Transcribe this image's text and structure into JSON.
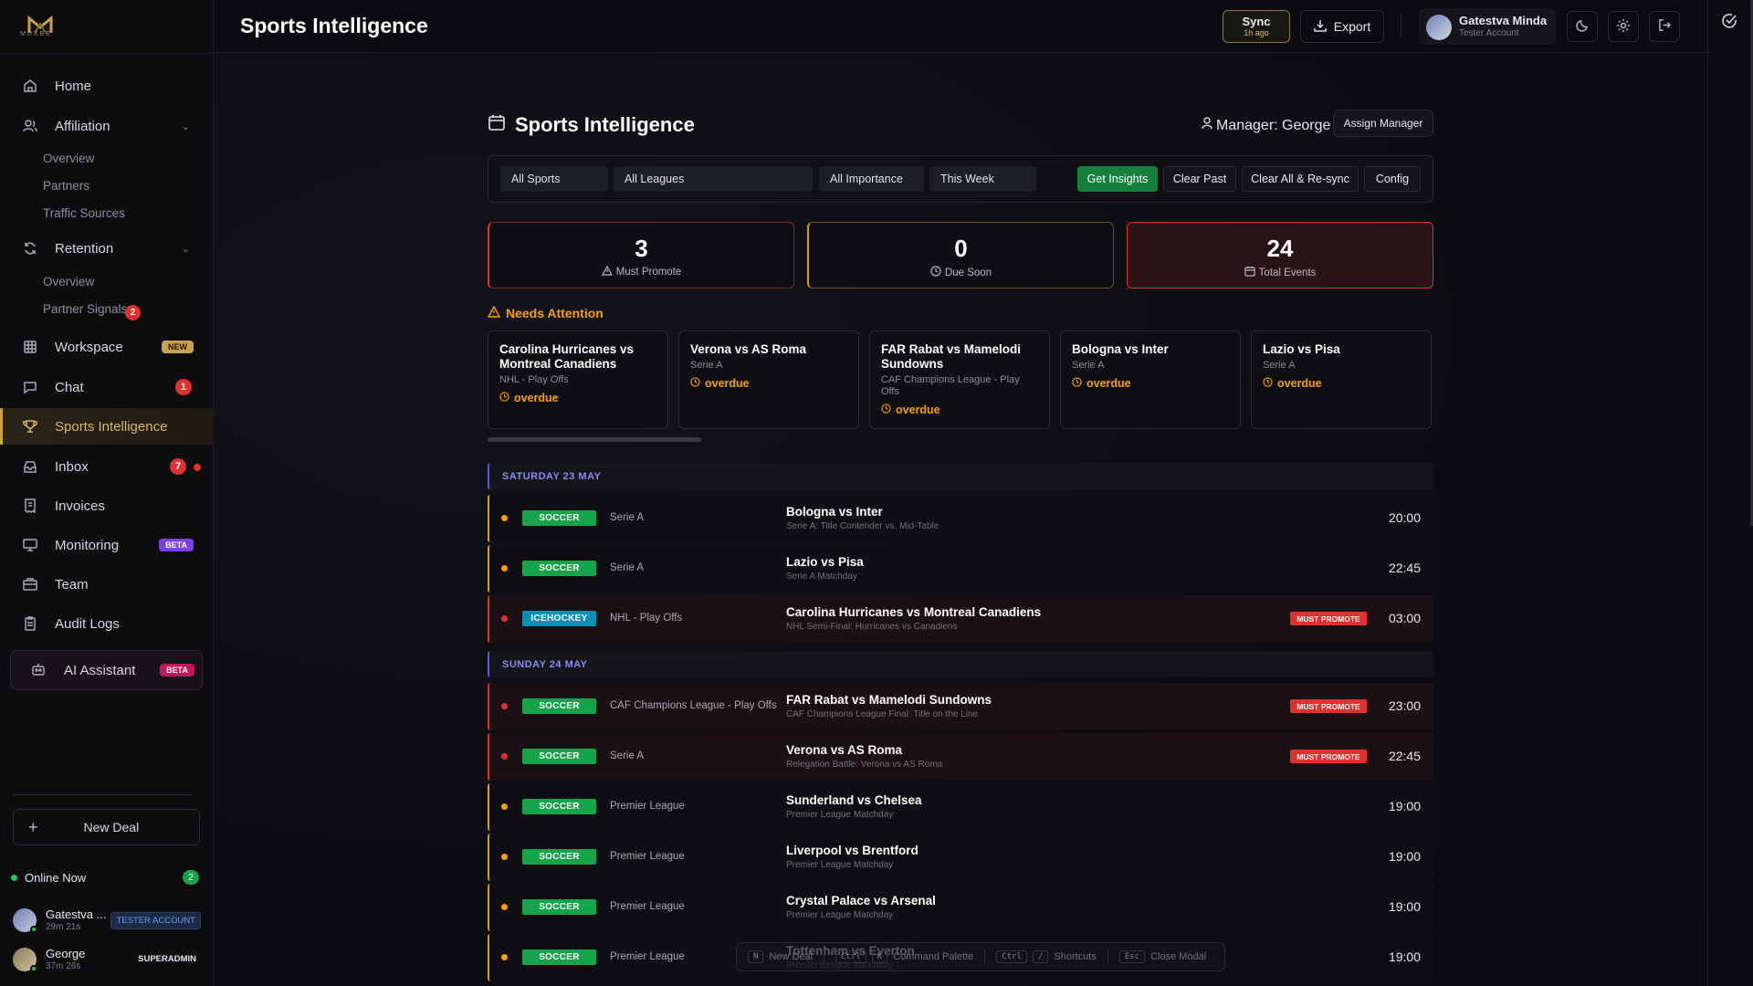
{
  "brand": {
    "name": "MUXBE"
  },
  "sidebar": {
    "items": [
      {
        "label": "Home",
        "icon": "home-icon"
      },
      {
        "label": "Affiliation",
        "icon": "users-icon",
        "sub": [
          "Overview",
          "Partners",
          "Traffic Sources"
        ]
      },
      {
        "label": "Retention",
        "icon": "refresh-icon",
        "sub": [
          "Overview",
          "Partner Signals"
        ],
        "sub_badge": "2"
      },
      {
        "label": "Workspace",
        "icon": "grid-icon",
        "badge": "NEW"
      },
      {
        "label": "Chat",
        "icon": "chat-icon",
        "count": "1"
      },
      {
        "label": "Sports Intelligence",
        "icon": "trophy-icon"
      },
      {
        "label": "Inbox",
        "icon": "inbox-icon",
        "count": "7"
      },
      {
        "label": "Invoices",
        "icon": "receipt-icon"
      },
      {
        "label": "Monitoring",
        "icon": "monitor-icon",
        "badge": "BETA"
      },
      {
        "label": "Team",
        "icon": "briefcase-icon"
      },
      {
        "label": "Audit Logs",
        "icon": "clipboard-icon"
      }
    ],
    "ai": {
      "label": "AI Assistant",
      "badge": "BETA"
    },
    "new_deal": "New Deal",
    "online": {
      "label": "Online Now",
      "count": "2"
    },
    "users": [
      {
        "name": "Gatestva ...",
        "time": "29m 21s",
        "role": "TESTER ACCOUNT"
      },
      {
        "name": "George",
        "time": "37m 26s",
        "role": "SUPERADMIN"
      }
    ]
  },
  "header": {
    "title": "Sports Intelligence",
    "sync": {
      "label": "Sync",
      "sub": "1h ago"
    },
    "export": "Export",
    "account": {
      "name": "Gatestva Minda",
      "role": "Tester Account"
    }
  },
  "main": {
    "title": "Sports Intelligence",
    "manager": "Manager: George",
    "assign": "Assign Manager",
    "filters": {
      "sports": "All Sports",
      "leagues": "All Leagues",
      "importance": "All Importance",
      "period": "This Week",
      "insights": "Get Insights",
      "clear_past": "Clear Past",
      "clear_all": "Clear All & Re-sync",
      "config": "Config"
    },
    "stats": [
      {
        "value": "3",
        "label": "Must Promote"
      },
      {
        "value": "0",
        "label": "Due Soon"
      },
      {
        "value": "24",
        "label": "Total Events"
      }
    ],
    "needs_attention": "Needs Attention",
    "attention_cards": [
      {
        "title": "Carolina Hurricanes vs Montreal Canadiens",
        "league": "NHL - Play Offs",
        "status": "overdue"
      },
      {
        "title": "Verona vs AS Roma",
        "league": "Serie A",
        "status": "overdue"
      },
      {
        "title": "FAR Rabat vs Mamelodi Sundowns",
        "league": "CAF Champions League - Play Offs",
        "status": "overdue"
      },
      {
        "title": "Bologna vs Inter",
        "league": "Serie A",
        "status": "overdue"
      },
      {
        "title": "Lazio vs Pisa",
        "league": "Serie A",
        "status": "overdue"
      }
    ],
    "days": [
      {
        "label": "SATURDAY 23 MAY",
        "events": [
          {
            "sport": "SOCCER",
            "league": "Serie A",
            "title": "Bologna vs Inter",
            "sub": "Serie A: Title Contender vs. Mid-Table",
            "time": "20:00",
            "must": false
          },
          {
            "sport": "SOCCER",
            "league": "Serie A",
            "title": "Lazio vs Pisa",
            "sub": "Serie A Matchday",
            "time": "22:45",
            "must": false
          },
          {
            "sport": "ICEHOCKEY",
            "league": "NHL - Play Offs",
            "title": "Carolina Hurricanes vs Montreal Canadiens",
            "sub": "NHL Semi-Final: Hurricanes vs Canadiens",
            "time": "03:00",
            "must": true
          }
        ]
      },
      {
        "label": "SUNDAY 24 MAY",
        "events": [
          {
            "sport": "SOCCER",
            "league": "CAF Champions League - Play Offs",
            "title": "FAR Rabat vs Mamelodi Sundowns",
            "sub": "CAF Champions League Final: Title on the Line",
            "time": "23:00",
            "must": true
          },
          {
            "sport": "SOCCER",
            "league": "Serie A",
            "title": "Verona vs AS Roma",
            "sub": "Relegation Battle: Verona vs AS Roma",
            "time": "22:45",
            "must": true
          },
          {
            "sport": "SOCCER",
            "league": "Premier League",
            "title": "Sunderland vs Chelsea",
            "sub": "Premier League Matchday",
            "time": "19:00",
            "must": false
          },
          {
            "sport": "SOCCER",
            "league": "Premier League",
            "title": "Liverpool vs Brentford",
            "sub": "Premier League Matchday",
            "time": "19:00",
            "must": false
          },
          {
            "sport": "SOCCER",
            "league": "Premier League",
            "title": "Crystal Palace vs Arsenal",
            "sub": "Premier League Matchday",
            "time": "19:00",
            "must": false
          },
          {
            "sport": "SOCCER",
            "league": "Premier League",
            "title": "Tottenham vs Everton",
            "sub": "Premier League Matchday",
            "time": "19:00",
            "must": false
          }
        ]
      }
    ],
    "must_promote_label": "MUST PROMOTE",
    "shortcuts": [
      {
        "keys": [
          "N"
        ],
        "label": "New Deal"
      },
      {
        "keys": [
          "Ctrl",
          "K"
        ],
        "label": "Command Palette"
      },
      {
        "keys": [
          "Ctrl",
          "/"
        ],
        "label": "Shortcuts"
      },
      {
        "keys": [
          "Esc"
        ],
        "label": "Close Modal"
      }
    ]
  },
  "colors": {
    "accent": "#c9a24a",
    "danger": "#e03131",
    "warning": "#f59f00",
    "success": "#15803d",
    "soccer": "#16a34a",
    "icehockey": "#0891b2"
  }
}
